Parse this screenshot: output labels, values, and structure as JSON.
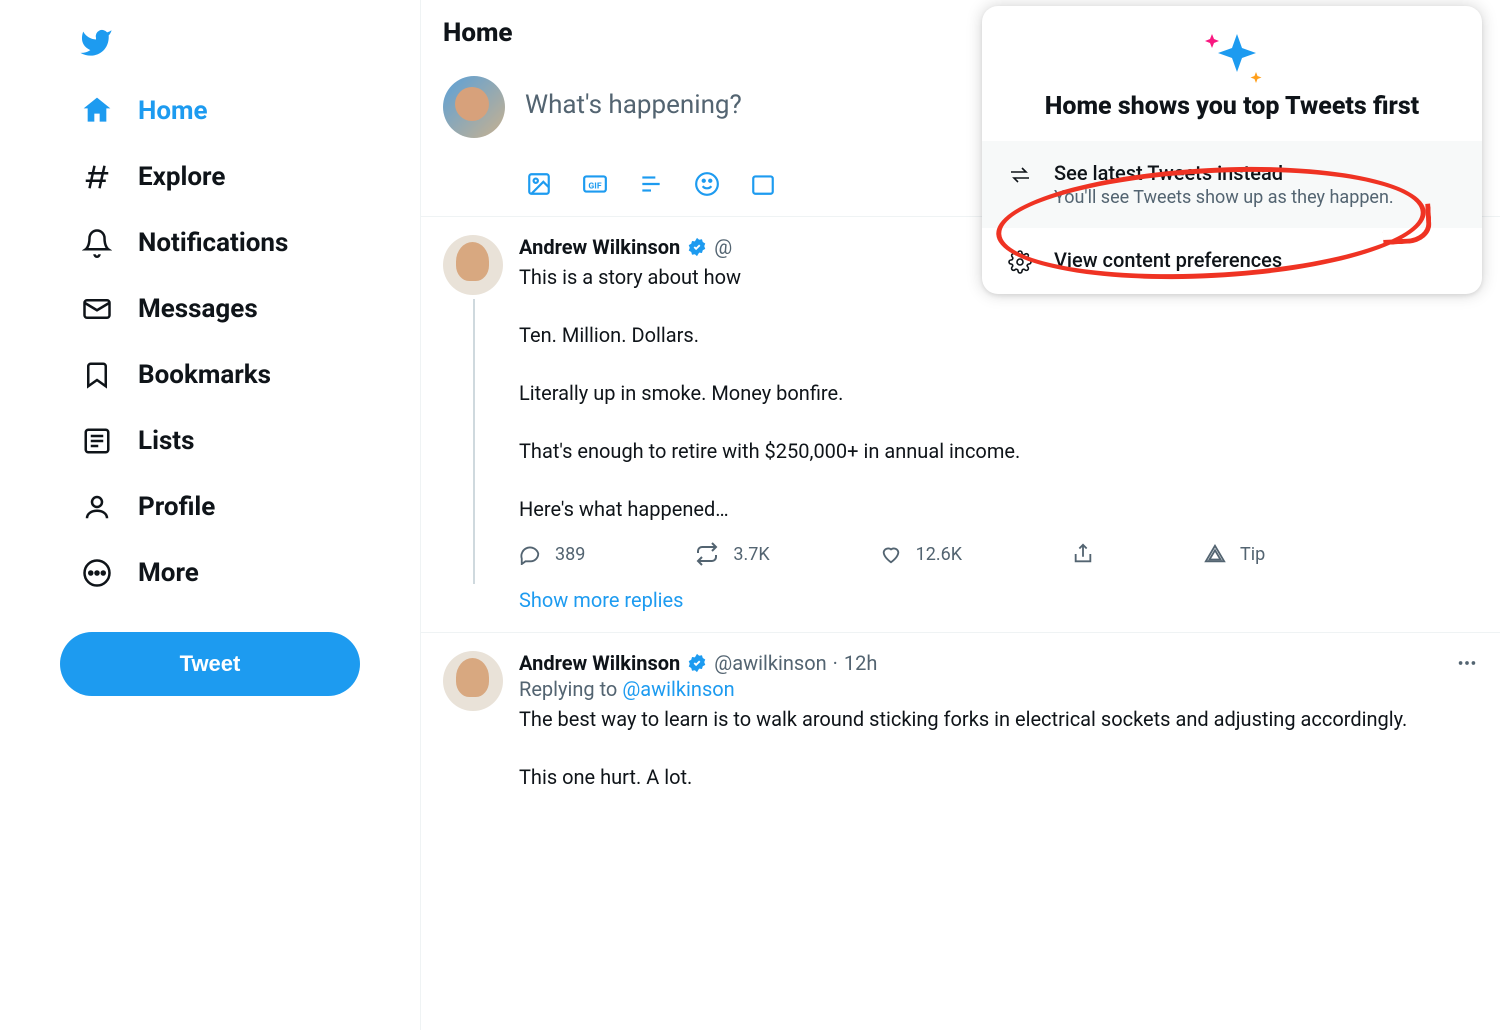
{
  "sidebar": {
    "tweet_button": "Tweet",
    "items": [
      {
        "label": "Home"
      },
      {
        "label": "Explore"
      },
      {
        "label": "Notifications"
      },
      {
        "label": "Messages"
      },
      {
        "label": "Bookmarks"
      },
      {
        "label": "Lists"
      },
      {
        "label": "Profile"
      },
      {
        "label": "More"
      }
    ]
  },
  "header": {
    "title": "Home"
  },
  "composer": {
    "placeholder": "What's happening?"
  },
  "popover": {
    "title": "Home shows you top Tweets first",
    "latest_title": "See latest Tweets instead",
    "latest_sub": "You'll see Tweets show up as they happen.",
    "prefs_title": "View content preferences"
  },
  "feed": {
    "show_more": "Show more replies",
    "tweets": [
      {
        "name": "Andrew Wilkinson",
        "handle": "@",
        "text": "This is a story about how\n\nTen. Million. Dollars.\n\nLiterally up in smoke. Money bonfire.\n\nThat's enough to retire with $250,000+ in annual income.\n\nHere's what happened…",
        "replies": "389",
        "retweets": "3.7K",
        "likes": "12.6K",
        "tip": "Tip"
      },
      {
        "name": "Andrew Wilkinson",
        "handle": "@awilkinson",
        "time": "12h",
        "reply_to_prefix": "Replying to ",
        "reply_to_handle": "@awilkinson",
        "text": "The best way to learn is to walk around sticking forks in electrical sockets and adjusting accordingly.\n\nThis one hurt. A lot."
      }
    ]
  }
}
